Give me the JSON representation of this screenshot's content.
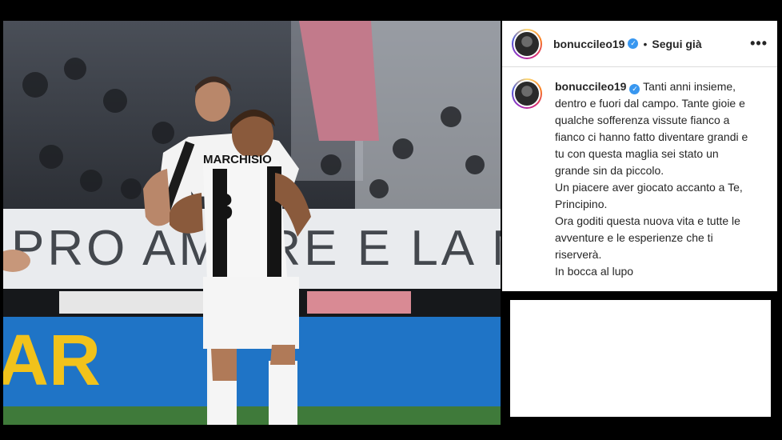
{
  "post": {
    "username": "bonuccileo19",
    "verified_icon": "verified-badge-icon",
    "separator": "•",
    "follow_label": "Segui già",
    "more_label": "•••",
    "caption_lines": [
      "Tanti anni insieme,",
      "dentro e fuori dal campo. Tante gioie e",
      "qualche sofferenza vissute fianco a",
      "fianco ci hanno fatto diventare grandi e",
      "tu con questa maglia sei stato un",
      "grande sin da piccolo.",
      "Un piacere aver giocato accanto a Te,",
      "Principino.",
      "Ora goditi questa nuova vita e tutte le",
      "avventure e le esperienze che ti",
      "riserverà.",
      "In bocca al lupo"
    ]
  },
  "photo": {
    "jersey_name": "MARCHISIO",
    "jersey_number": "8",
    "banner_text": "PRO AMORE E LA NOSTRA",
    "ad_text": "AR"
  },
  "colors": {
    "verified": "#3897f0",
    "text": "#262626",
    "pitch": "#3f7a3a",
    "ad_board": "#1f74c6"
  }
}
